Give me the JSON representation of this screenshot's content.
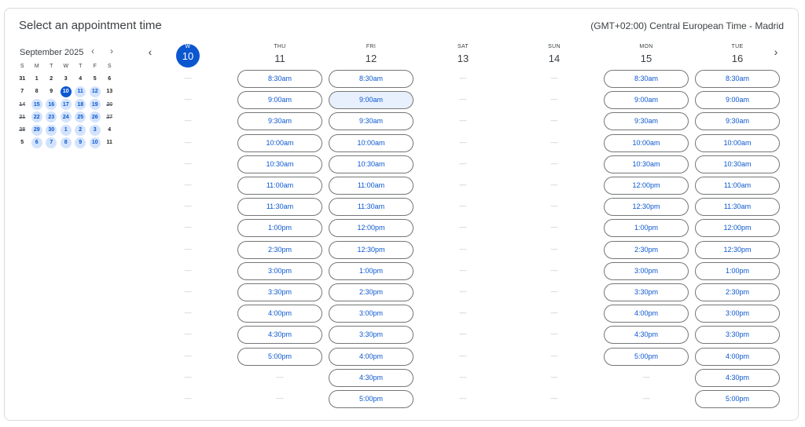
{
  "header": {
    "title": "Select an appointment time",
    "timezone": "(GMT+02:00) Central European Time - Madrid"
  },
  "mini_calendar": {
    "month_label": "September 2025",
    "prev_icon": "chevron-left-icon",
    "next_icon": "chevron-right-icon",
    "weekdays": [
      "S",
      "M",
      "T",
      "W",
      "T",
      "F",
      "S"
    ],
    "weeks": [
      [
        {
          "d": "31",
          "s": "out-bold"
        },
        {
          "d": "1",
          "s": "bold"
        },
        {
          "d": "2",
          "s": "bold"
        },
        {
          "d": "3",
          "s": "bold"
        },
        {
          "d": "4",
          "s": "bold"
        },
        {
          "d": "5",
          "s": "bold"
        },
        {
          "d": "6",
          "s": "bold"
        }
      ],
      [
        {
          "d": "7",
          "s": "bold"
        },
        {
          "d": "8",
          "s": "bold"
        },
        {
          "d": "9",
          "s": "bold"
        },
        {
          "d": "10",
          "s": "sel"
        },
        {
          "d": "11",
          "s": "avail"
        },
        {
          "d": "12",
          "s": "avail"
        },
        {
          "d": "13",
          "s": "bold"
        }
      ],
      [
        {
          "d": "14",
          "s": "strike"
        },
        {
          "d": "15",
          "s": "avail"
        },
        {
          "d": "16",
          "s": "avail"
        },
        {
          "d": "17",
          "s": "avail"
        },
        {
          "d": "18",
          "s": "avail"
        },
        {
          "d": "19",
          "s": "avail"
        },
        {
          "d": "20",
          "s": "strike"
        }
      ],
      [
        {
          "d": "21",
          "s": "strike"
        },
        {
          "d": "22",
          "s": "avail"
        },
        {
          "d": "23",
          "s": "avail"
        },
        {
          "d": "24",
          "s": "avail"
        },
        {
          "d": "25",
          "s": "avail"
        },
        {
          "d": "26",
          "s": "avail"
        },
        {
          "d": "27",
          "s": "strike"
        }
      ],
      [
        {
          "d": "28",
          "s": "strike"
        },
        {
          "d": "29",
          "s": "avail"
        },
        {
          "d": "30",
          "s": "avail"
        },
        {
          "d": "1",
          "s": "avail"
        },
        {
          "d": "2",
          "s": "avail"
        },
        {
          "d": "3",
          "s": "avail"
        },
        {
          "d": "4",
          "s": "bold"
        }
      ],
      [
        {
          "d": "5",
          "s": "bold"
        },
        {
          "d": "6",
          "s": "avail"
        },
        {
          "d": "7",
          "s": "avail"
        },
        {
          "d": "8",
          "s": "avail"
        },
        {
          "d": "9",
          "s": "avail"
        },
        {
          "d": "10",
          "s": "avail"
        },
        {
          "d": "11",
          "s": "bold"
        }
      ]
    ]
  },
  "week": {
    "prev_icon": "chevron-left-icon",
    "next_icon": "chevron-right-icon",
    "dash": "—",
    "days": [
      {
        "name": "W",
        "num": "10",
        "today": true,
        "slots": []
      },
      {
        "name": "THU",
        "num": "11",
        "today": false,
        "slots": [
          "8:30am",
          "9:00am",
          "9:30am",
          "10:00am",
          "10:30am",
          "11:00am",
          "11:30am",
          "1:00pm",
          "2:30pm",
          "3:00pm",
          "3:30pm",
          "4:00pm",
          "4:30pm",
          "5:00pm"
        ]
      },
      {
        "name": "FRI",
        "num": "12",
        "today": false,
        "highlight": "9:00am",
        "slots": [
          "8:30am",
          "9:00am",
          "9:30am",
          "10:00am",
          "10:30am",
          "11:00am",
          "11:30am",
          "12:00pm",
          "12:30pm",
          "1:00pm",
          "2:30pm",
          "3:00pm",
          "3:30pm",
          "4:00pm",
          "4:30pm",
          "5:00pm"
        ]
      },
      {
        "name": "SAT",
        "num": "13",
        "today": false,
        "slots": []
      },
      {
        "name": "SUN",
        "num": "14",
        "today": false,
        "slots": []
      },
      {
        "name": "MON",
        "num": "15",
        "today": false,
        "slots": [
          "8:30am",
          "9:00am",
          "9:30am",
          "10:00am",
          "10:30am",
          "12:00pm",
          "12:30pm",
          "1:00pm",
          "2:30pm",
          "3:00pm",
          "3:30pm",
          "4:00pm",
          "4:30pm",
          "5:00pm"
        ]
      },
      {
        "name": "TUE",
        "num": "16",
        "today": false,
        "slots": [
          "8:30am",
          "9:00am",
          "9:30am",
          "10:00am",
          "10:30am",
          "11:00am",
          "11:30am",
          "12:00pm",
          "12:30pm",
          "1:00pm",
          "2:30pm",
          "3:00pm",
          "3:30pm",
          "4:00pm",
          "4:30pm",
          "5:00pm"
        ]
      }
    ]
  },
  "colors": {
    "accent": "#0b57d0",
    "available_bg": "#d3e3fd",
    "hover_bg": "#e8f0fe",
    "border": "#747775"
  }
}
